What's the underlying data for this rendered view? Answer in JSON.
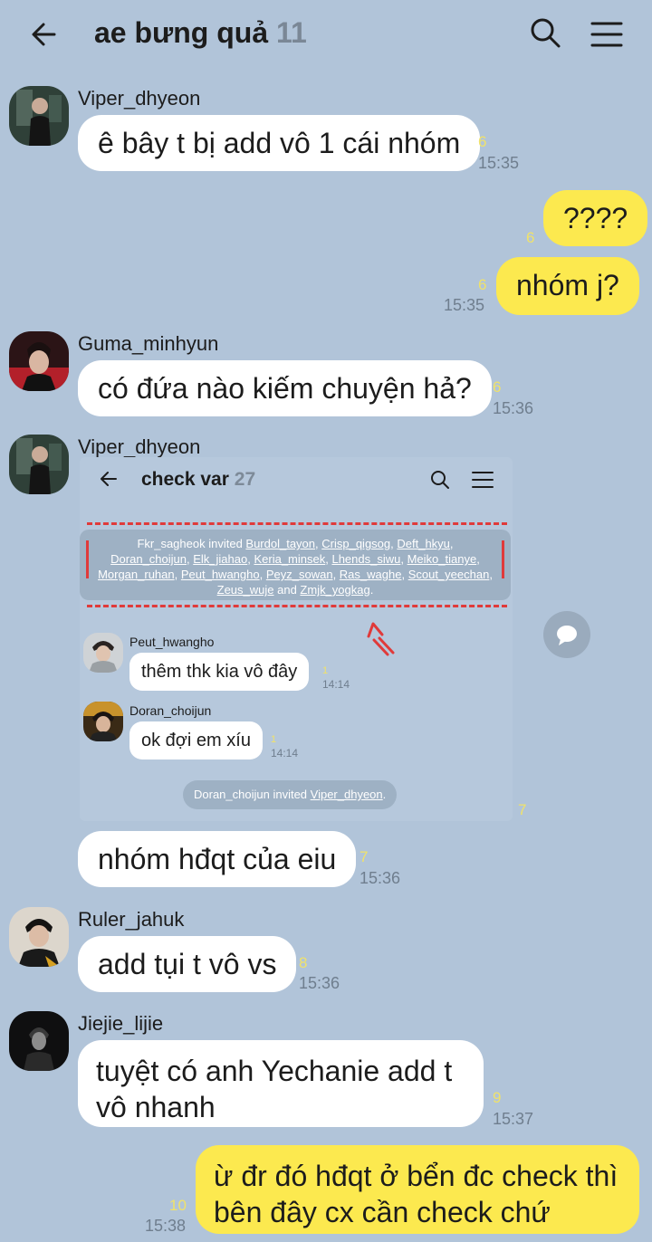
{
  "header": {
    "title": "ae bưng quả",
    "member_count": "11"
  },
  "messages": [
    {
      "sender": "Viper_dhyeon",
      "text": "ê bây t bị add vô 1 cái nhóm",
      "unread": "6",
      "time": "15:35"
    },
    {
      "sender": "me",
      "text": "????",
      "unread": "6",
      "time": ""
    },
    {
      "sender": "me",
      "text": "nhóm j?",
      "unread": "6",
      "time": "15:35"
    },
    {
      "sender": "Guma_minhyun",
      "text": "có đứa nào kiếm chuyện hả?",
      "unread": "6",
      "time": "15:36"
    },
    {
      "sender": "Viper_dhyeon",
      "text": "[image]",
      "unread": "7",
      "time": ""
    },
    {
      "sender": "Viper_dhyeon",
      "text": "nhóm hđqt của eiu",
      "unread": "7",
      "time": "15:36"
    },
    {
      "sender": "Ruler_jahuk",
      "text": "add tụi t vô vs",
      "unread": "8",
      "time": "15:36"
    },
    {
      "sender": "Jiejie_lijie",
      "text": "tuyệt có anh Yechanie add t vô nhanh",
      "unread": "9",
      "time": "15:37"
    },
    {
      "sender": "me",
      "text": "ừ đr đó hđqt ở bển đc check thì bên đây cx cần check chứ",
      "unread": "10",
      "time": "15:38"
    }
  ],
  "embedded": {
    "title": "check var",
    "member_count": "27",
    "notice": {
      "inviter": "Fkr_sagheok invited ",
      "line1_names": [
        "Burdol_tayon",
        "Crisp_qigsog",
        "Deft_hkyu"
      ],
      "line2_names": [
        "Doran_choijun",
        "Elk_jiahao",
        "Keria_minsek",
        "Lhends_siwu",
        "Meiko_tianye"
      ],
      "line3_names": [
        "Morgan_ruhan",
        "Peut_hwangho",
        "Peyz_sowan",
        "Ras_waghe",
        "Scout_yeechan"
      ],
      "line4_a": "Zeus_wuje",
      "line4_and": " and ",
      "line4_b": "Zmjk_yogkag",
      "line4_end": "."
    },
    "msg1": {
      "sender": "Peut_hwangho",
      "text": "thêm thk kia vô đây",
      "unread": "1",
      "time": "14:14"
    },
    "msg2": {
      "sender": "Doran_choijun",
      "text": "ok đợi em xíu",
      "unread": "1",
      "time": "14:14"
    },
    "system": {
      "prefix": "Doran_choijun invited ",
      "name": "Viper_dhyeon",
      "suffix": "."
    }
  }
}
